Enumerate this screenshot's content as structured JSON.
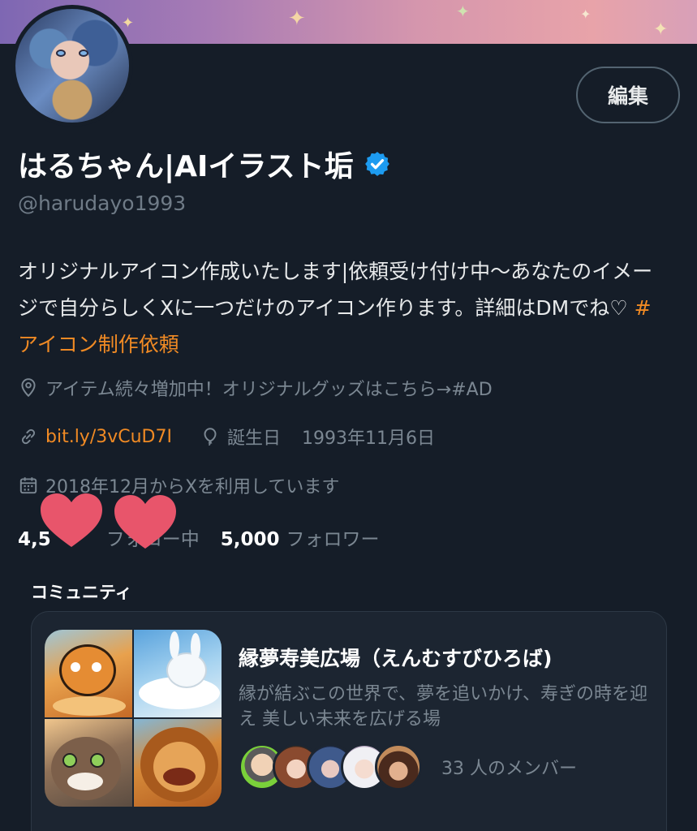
{
  "profile": {
    "display_name": "はるちゃん|AIイラスト垢",
    "handle": "@harudayo1993",
    "edit_label": "編集",
    "verified": true,
    "bio": {
      "text": "オリジナルアイコン作成いたします|依頼受け付け中〜あなたのイメージで自分らしくXに一つだけのアイコン作ります。詳細はDMでね♡ ",
      "hashtag": "#アイコン制作依頼"
    },
    "location": "アイテム続々増加中！オリジナルグッズはこちら→#AD",
    "link": "bit.ly/3vCuD7I",
    "birthday_label": "誕生日",
    "birthday": "1993年11月6日",
    "joined": "2018年12月からXを利用しています",
    "following_count": "4,5",
    "following_label": "フォロー中",
    "followers_count": "5,000",
    "followers_label": "フォロワー"
  },
  "community": {
    "heading": "コミュニティ",
    "name": "縁夢寿美広場（えんむすびひろば)",
    "description": "縁が結ぶこの世界で、夢を追いかけ、寿ぎの時を迎え 美しい未来を広げる場",
    "member_count": "33 人のメンバー"
  },
  "colors": {
    "background": "#151d28",
    "accent_link": "#f08a24",
    "verified_badge": "#1d9bf0",
    "muted_text": "#7b8792",
    "sticker_heart": "#e8556b"
  },
  "icons": [
    "location-pin-icon",
    "link-icon",
    "balloon-icon",
    "calendar-icon",
    "verified-badge-icon"
  ]
}
